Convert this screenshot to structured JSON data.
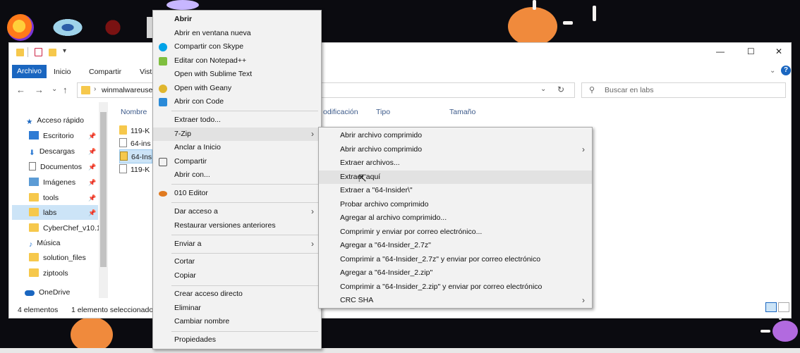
{
  "window": {
    "ribbon_tabs": [
      "Archivo",
      "Inicio",
      "Compartir",
      "Vista"
    ],
    "minimize": "—",
    "maximize": "☐",
    "close": "✕",
    "help": "?"
  },
  "address": {
    "path": "winmalwareuse",
    "search_placeholder": "Buscar en labs"
  },
  "nav": {
    "items": [
      {
        "label": "Acceso rápido",
        "icon": "star-icon"
      },
      {
        "label": "Escritorio",
        "icon": "desktop-icon"
      },
      {
        "label": "Descargas",
        "icon": "download-icon"
      },
      {
        "label": "Documentos",
        "icon": "document-icon"
      },
      {
        "label": "Imágenes",
        "icon": "image-icon"
      },
      {
        "label": "tools",
        "icon": "folder-icon"
      },
      {
        "label": "labs",
        "icon": "folder-icon"
      },
      {
        "label": "CyberChef_v10.1",
        "icon": "folder-icon"
      },
      {
        "label": "Música",
        "icon": "music-icon"
      },
      {
        "label": "solution_files",
        "icon": "folder-icon"
      },
      {
        "label": "ziptools",
        "icon": "folder-icon"
      },
      {
        "label": "OneDrive",
        "icon": "cloud-icon"
      }
    ]
  },
  "columns": {
    "name": "Nombre",
    "modified": "odificación",
    "type": "Tipo",
    "size": "Tamaño"
  },
  "files": [
    "119-K",
    "64-ins",
    "64-Ins",
    "119-K"
  ],
  "status": {
    "count": "4 elementos",
    "selected": "1 elemento seleccionado"
  },
  "context_menu": {
    "items": [
      {
        "label": "Abrir",
        "bold": true
      },
      {
        "label": "Abrir en ventana nueva"
      },
      {
        "label": "Compartir con Skype",
        "icon": "skype-icon",
        "color": "#00a3e8"
      },
      {
        "label": "Editar con Notepad++",
        "icon": "notepadpp-icon",
        "color": "#7fbf3f"
      },
      {
        "label": "Open with Sublime Text"
      },
      {
        "label": "Open with Geany",
        "icon": "geany-icon",
        "color": "#e0b62e"
      },
      {
        "label": "Abrir con Code",
        "icon": "vscode-icon",
        "color": "#2a8ad8"
      },
      {
        "label": "Extraer todo..."
      },
      {
        "label": "7-Zip",
        "submenu": true
      },
      {
        "label": "Anclar a Inicio"
      },
      {
        "label": "Compartir",
        "icon": "share-icon",
        "color": "#555555"
      },
      {
        "label": "Abrir con..."
      },
      {
        "label": "010 Editor",
        "icon": "010-editor-icon",
        "color": "#e07a20"
      },
      {
        "label": "Dar acceso a",
        "submenu": true
      },
      {
        "label": "Restaurar versiones anteriores"
      },
      {
        "label": "Enviar a",
        "submenu": true
      },
      {
        "label": "Cortar"
      },
      {
        "label": "Copiar"
      },
      {
        "label": "Crear acceso directo"
      },
      {
        "label": "Eliminar"
      },
      {
        "label": "Cambiar nombre"
      },
      {
        "label": "Propiedades"
      }
    ]
  },
  "submenu": {
    "items": [
      {
        "label": "Abrir archivo comprimido"
      },
      {
        "label": "Abrir archivo comprimido",
        "submenu": true
      },
      {
        "label": "Extraer archivos..."
      },
      {
        "label": "Extraer aquí",
        "highlighted": true
      },
      {
        "label": "Extraer a \"64-Insider\\\""
      },
      {
        "label": "Probar archivo comprimido"
      },
      {
        "label": "Agregar al archivo comprimido..."
      },
      {
        "label": "Comprimir y enviar por correo electrónico..."
      },
      {
        "label": "Agregar a \"64-Insider_2.7z\""
      },
      {
        "label": "Comprimir a \"64-Insider_2.7z\" y enviar por correo electrónico"
      },
      {
        "label": "Agregar a \"64-Insider_2.zip\""
      },
      {
        "label": "Comprimir a \"64-Insider_2.zip\" y enviar por correo electrónico"
      },
      {
        "label": "CRC SHA",
        "submenu": true
      }
    ]
  },
  "colors": {
    "accent": "#1a66c0",
    "folder": "#f6c84c",
    "virus": "#f08a3c"
  }
}
